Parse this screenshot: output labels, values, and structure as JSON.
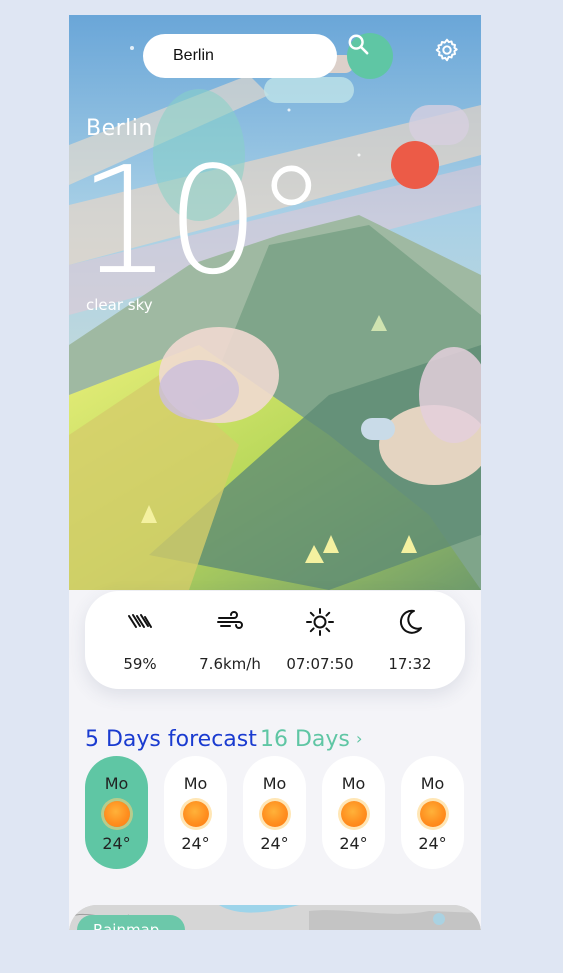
{
  "search": {
    "value": "Berlin"
  },
  "location": {
    "city": "Berlin"
  },
  "current": {
    "temperature": "10°",
    "condition": "clear sky",
    "humidity": "59%",
    "wind": "7.6km/h",
    "sunrise": "07:07:50",
    "sunset": "17:32"
  },
  "forecast": {
    "title": "5 Days forecast",
    "link": "16 Days",
    "days": [
      {
        "name": "Mo",
        "temp": "24°"
      },
      {
        "name": "Mo",
        "temp": "24°"
      },
      {
        "name": "Mo",
        "temp": "24°"
      },
      {
        "name": "Mo",
        "temp": "24°"
      },
      {
        "name": "Mo",
        "temp": "24°"
      }
    ]
  },
  "map": {
    "label": "Rainmap"
  },
  "colors": {
    "accent": "#5fc6a4",
    "title_blue": "#1a3bd0",
    "sun": "#ff8f1f",
    "red_sun": "#ec5b47"
  },
  "icons": [
    "search-icon",
    "gear-icon",
    "rain-icon",
    "wind-icon",
    "sun-icon",
    "moon-icon",
    "chevron-right-icon"
  ]
}
